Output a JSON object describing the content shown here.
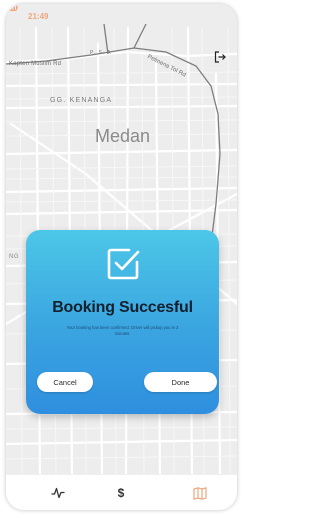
{
  "status_bar": {
    "time": "21:49",
    "time_color": "#f0a67d"
  },
  "map": {
    "labels": {
      "road_left": "Kapten Muslim Rd",
      "psa": "P. S. A",
      "pelmena": "Pelmena Tol Rd",
      "district": "GG. KENANGA",
      "city": "Medan",
      "left_edge": "NG"
    }
  },
  "dialog": {
    "title": "Booking Succesful",
    "message": "Your booking has been confirmed. Driver will pickup you in 2 minutes.",
    "cancel_label": "Cancel",
    "done_label": "Done",
    "gradient_top": "#4cc7e8",
    "gradient_bottom": "#2f8fdf"
  },
  "bottom_nav": {
    "items": [
      {
        "icon": "activity-icon"
      },
      {
        "icon": "dollar-icon",
        "label": "$"
      },
      {
        "icon": "map-icon",
        "color": "#f0a67d"
      }
    ]
  }
}
